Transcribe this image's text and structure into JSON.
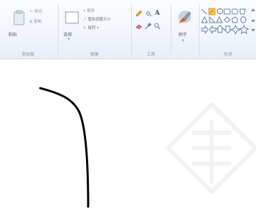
{
  "ribbon": {
    "clipboard": {
      "paste_label": "粘贴",
      "cut_label": "剪切",
      "copy_label": "复制",
      "group_label": "剪贴板"
    },
    "image": {
      "select_label": "选择",
      "crop_label": "裁剪",
      "resize_label": "重新调整大小",
      "rotate_label": "旋转",
      "group_label": "图像"
    },
    "tools": {
      "text_tool_label": "A",
      "group_label": "工具"
    },
    "brushes": {
      "label": "刷子"
    },
    "shapes": {
      "group_label": "形状"
    }
  },
  "canvas": {
    "background": "#ffffff",
    "stroke_color": "#000000"
  },
  "colors": {
    "ribbon_bg": "#f2f6fb",
    "accent": "#f5b400"
  }
}
